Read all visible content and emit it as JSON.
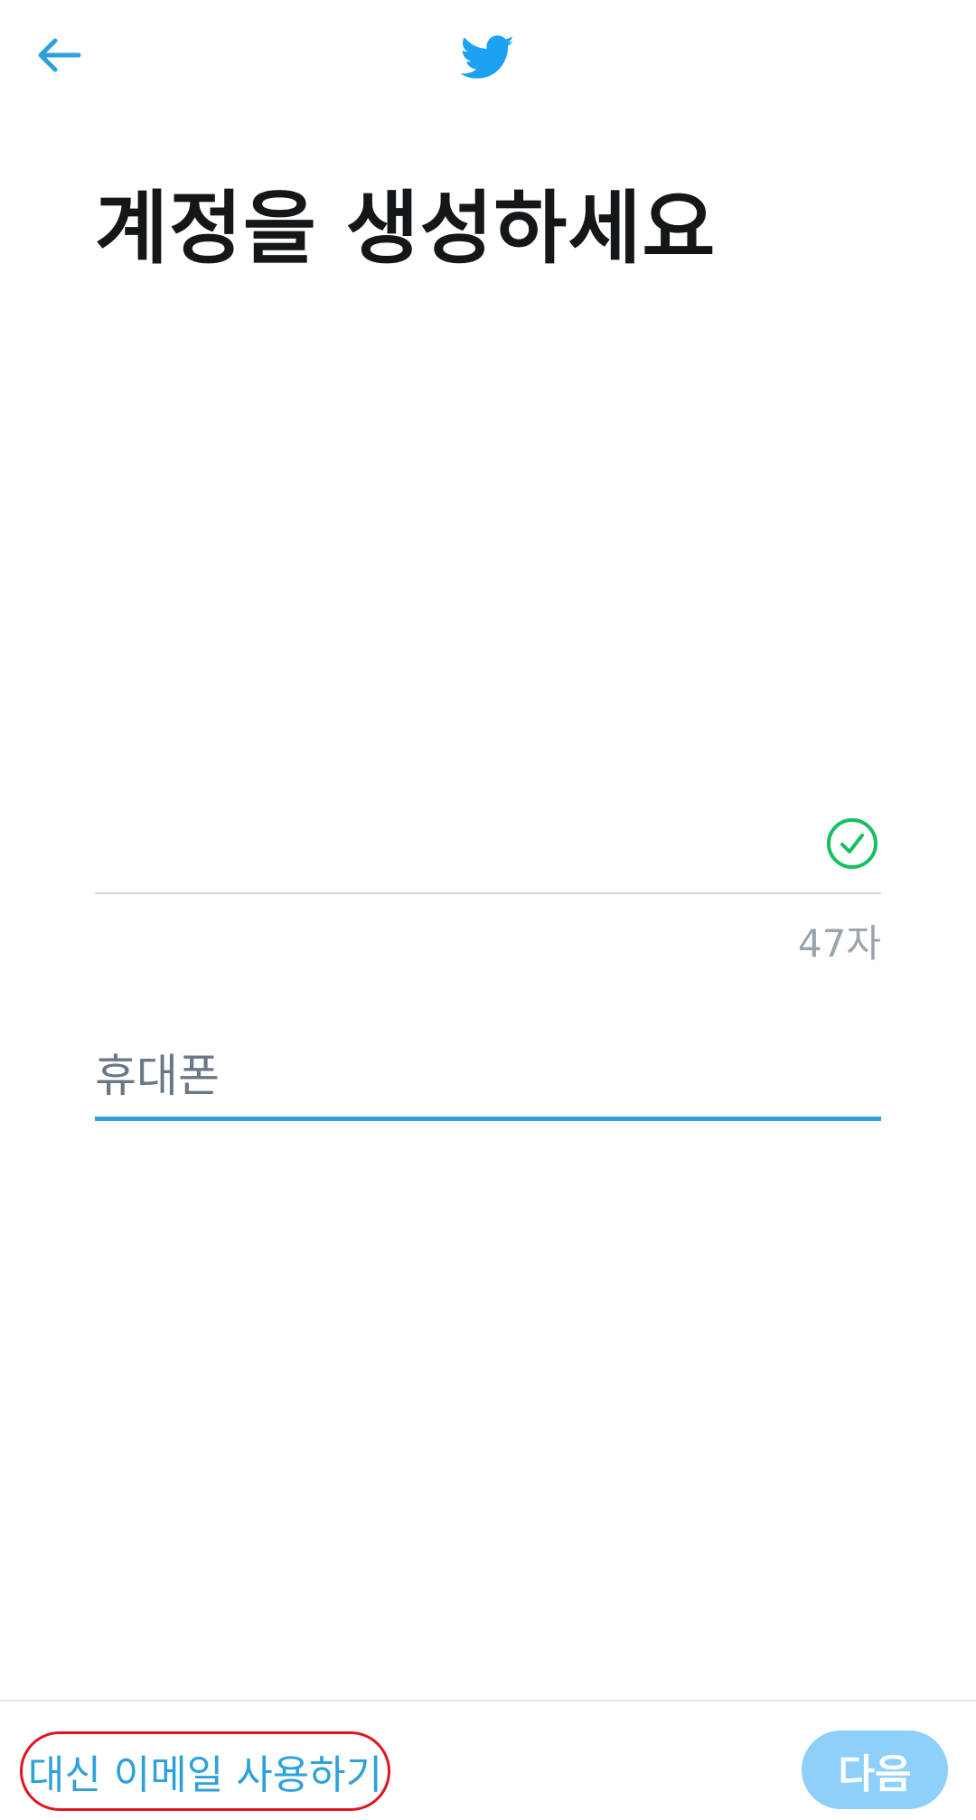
{
  "header": {
    "back_icon": "arrow-left-icon",
    "logo_icon": "twitter-bird-icon",
    "brand_color": "#1da1f2"
  },
  "page_title": "계정을 생성하세요",
  "name_field": {
    "value": "",
    "valid_icon": "check-circle-icon",
    "valid_color": "#17bf63",
    "char_count": "47자"
  },
  "phone_field": {
    "value": "",
    "placeholder": "휴대폰",
    "focus_color": "#2ea1da"
  },
  "footer": {
    "use_email_label": "대신 이메일 사용하기",
    "next_label": "다음",
    "next_disabled_color": "#8ed0f9"
  }
}
